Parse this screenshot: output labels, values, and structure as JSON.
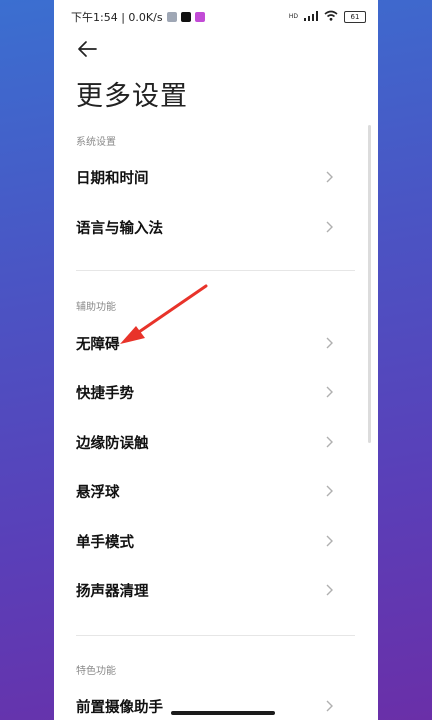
{
  "status_bar": {
    "time_speed": "下午1:54 | 0.0K/s",
    "network_label": "HD",
    "battery_level": "61"
  },
  "page": {
    "title": "更多设置"
  },
  "sections": [
    {
      "header": "系统设置",
      "items": [
        "日期和时间",
        "语言与输入法"
      ]
    },
    {
      "header": "辅助功能",
      "items": [
        "无障碍",
        "快捷手势",
        "边缘防误触",
        "悬浮球",
        "单手模式",
        "扬声器清理"
      ]
    },
    {
      "header": "特色功能",
      "items": [
        "前置摄像助手"
      ]
    }
  ],
  "icons": {
    "back": "arrow-left-icon",
    "chevron": "chevron-right-icon",
    "signal": "signal-icon",
    "wifi": "wifi-icon",
    "battery": "battery-icon"
  },
  "colors": {
    "annotation_arrow": "#e8332a",
    "section_header": "#8a8a8a"
  }
}
